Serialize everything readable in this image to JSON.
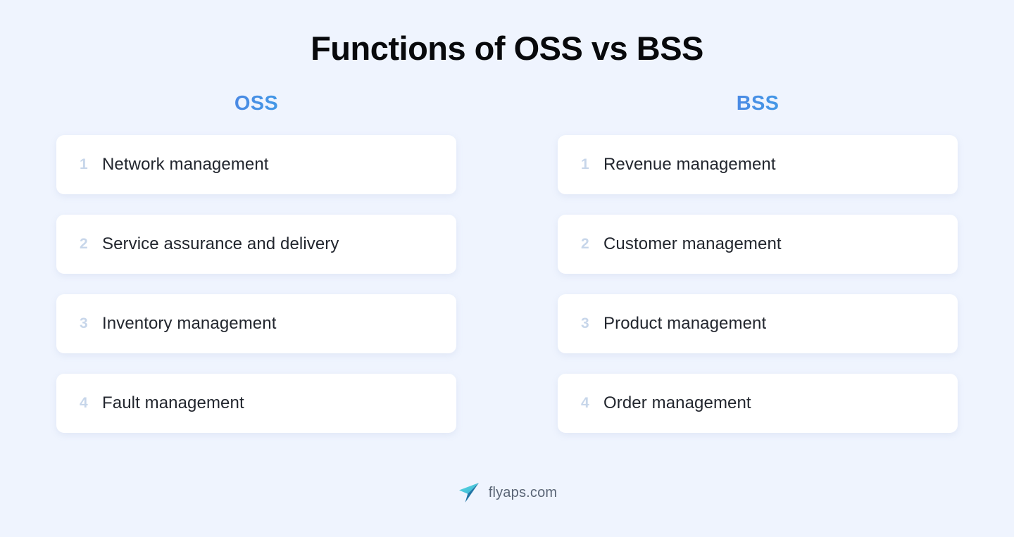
{
  "title": "Functions of OSS vs BSS",
  "columns": [
    {
      "header": "OSS",
      "items": [
        {
          "number": "1",
          "label": "Network management"
        },
        {
          "number": "2",
          "label": "Service assurance and delivery"
        },
        {
          "number": "3",
          "label": "Inventory management"
        },
        {
          "number": "4",
          "label": "Fault management"
        }
      ]
    },
    {
      "header": "BSS",
      "items": [
        {
          "number": "1",
          "label": "Revenue management"
        },
        {
          "number": "2",
          "label": "Customer management"
        },
        {
          "number": "3",
          "label": "Product management"
        },
        {
          "number": "4",
          "label": "Order management"
        }
      ]
    }
  ],
  "footer": {
    "brand": "flyaps.com",
    "logo_icon": "paper-plane-icon"
  },
  "colors": {
    "background": "#eff4fe",
    "card_background": "#ffffff",
    "title_text": "#08090c",
    "item_text": "#22262e",
    "item_number": "#c7d6ea",
    "gradient_start": "#4f5fd9",
    "gradient_mid": "#4a8ae4",
    "gradient_end": "#29d4f0",
    "footer_text": "#5a6576",
    "logo_teal": "#3fd0d8",
    "logo_dark": "#1b5c8f"
  }
}
